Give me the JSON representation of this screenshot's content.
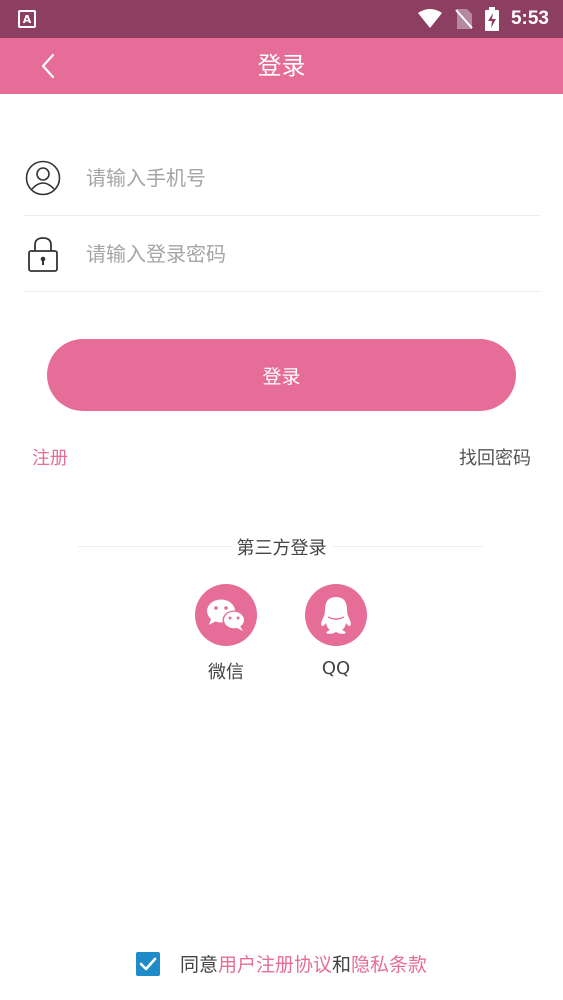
{
  "status_bar": {
    "app_badge": "A",
    "time": "5:53",
    "icons": [
      "wifi-icon",
      "no-sim-icon",
      "battery-charging-icon"
    ]
  },
  "app_bar": {
    "back_icon": "chevron-left-icon",
    "title": "登录"
  },
  "form": {
    "phone": {
      "icon": "user-icon",
      "placeholder": "请输入手机号",
      "value": ""
    },
    "password": {
      "icon": "lock-icon",
      "placeholder": "请输入登录密码",
      "value": ""
    },
    "login_button": "登录",
    "register_link": "注册",
    "forgot_link": "找回密码"
  },
  "third_party": {
    "title": "第三方登录",
    "providers": [
      {
        "icon": "wechat-icon",
        "label": "微信"
      },
      {
        "icon": "qq-icon",
        "label": "QQ"
      }
    ]
  },
  "agreement": {
    "checked": true,
    "prefix": "同意",
    "terms_link": "用户注册协议",
    "conjunction": "和",
    "privacy_link": "隐私条款"
  },
  "colors": {
    "status_bar": "#8d3f62",
    "primary": "#e66d97",
    "checkbox": "#1f8bc9"
  }
}
